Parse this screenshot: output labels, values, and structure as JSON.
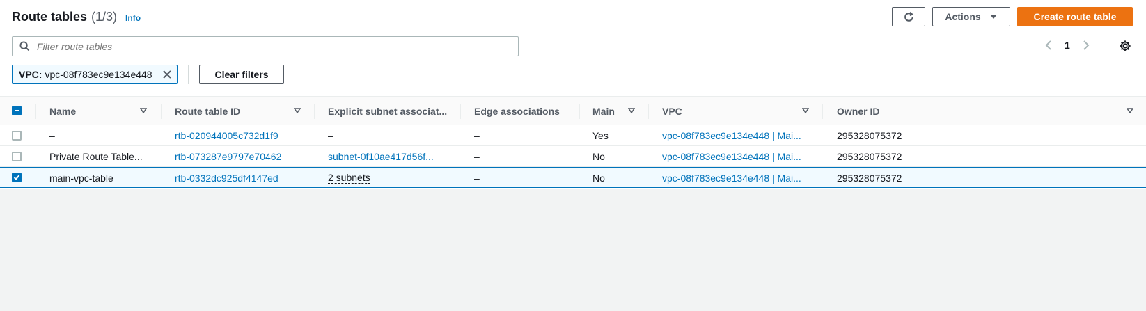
{
  "header": {
    "title": "Route tables",
    "count": "(1/3)",
    "info_label": "Info",
    "actions_label": "Actions",
    "create_label": "Create route table"
  },
  "search": {
    "placeholder": "Filter route tables"
  },
  "pagination": {
    "current_page": "1"
  },
  "filter_token": {
    "key": "VPC:",
    "value": "vpc-08f783ec9e134e448"
  },
  "clear_filters_label": "Clear filters",
  "columns": {
    "name": "Name",
    "route_table_id": "Route table ID",
    "explicit_subnet": "Explicit subnet associat...",
    "edge": "Edge associations",
    "main": "Main",
    "vpc": "VPC",
    "owner": "Owner ID"
  },
  "rows": [
    {
      "selected": false,
      "name": "–",
      "route_table_id": "rtb-020944005c732d1f9",
      "explicit_subnet": "–",
      "edge": "–",
      "main": "Yes",
      "vpc": "vpc-08f783ec9e134e448 | Mai...",
      "owner": "295328075372"
    },
    {
      "selected": false,
      "name": "Private Route Table...",
      "route_table_id": "rtb-073287e9797e70462",
      "explicit_subnet": "subnet-0f10ae417d56f...",
      "edge": "–",
      "main": "No",
      "vpc": "vpc-08f783ec9e134e448 | Mai...",
      "owner": "295328075372"
    },
    {
      "selected": true,
      "name": "main-vpc-table",
      "route_table_id": "rtb-0332dc925df4147ed",
      "explicit_subnet": "2 subnets",
      "edge": "–",
      "main": "No",
      "vpc": "vpc-08f783ec9e134e448 | Mai...",
      "owner": "295328075372"
    }
  ],
  "colors": {
    "accent": "#0073bb",
    "primary_button": "#ec7211",
    "selected_row_bg": "#f1faff"
  }
}
